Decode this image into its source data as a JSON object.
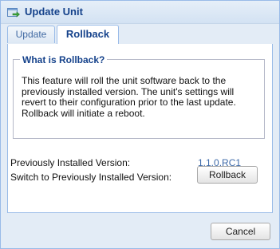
{
  "window": {
    "title": "Update Unit",
    "icon": "update-arrow-icon"
  },
  "tabs": [
    {
      "label": "Update",
      "active": false
    },
    {
      "label": "Rollback",
      "active": true
    }
  ],
  "rollback": {
    "section_title": "What is Rollback?",
    "description": "This feature will roll the unit software back to the previously installed version. The unit's settings will revert to their configuration prior to the last update. Rollback will initiate a reboot.",
    "previous_version_label": "Previously Installed Version:",
    "previous_version_value": "1.1.0.RC1",
    "switch_label": "Switch to Previously Installed Version:",
    "rollback_button": "Rollback"
  },
  "footer": {
    "cancel_button": "Cancel"
  },
  "colors": {
    "accent": "#15428b",
    "border": "#99bbe8",
    "window_bg": "#e3ecf6",
    "version_text": "#3b68a8"
  }
}
